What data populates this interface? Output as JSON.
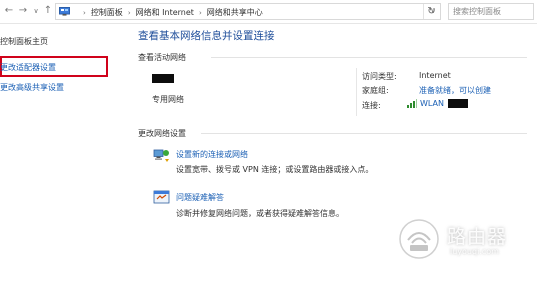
{
  "addressbar": {
    "back_icon": "arrow-left-icon",
    "forward_icon": "arrow-right-icon",
    "dropdown_icon": "chevron-down-icon",
    "up_icon": "arrow-up-icon",
    "breadcrumbs": [
      "控制面板",
      "网络和 Internet",
      "网络和共享中心"
    ],
    "refresh_icon": "refresh-icon",
    "search_placeholder": "搜索控制面板"
  },
  "sidebar": {
    "home": "控制面板主页",
    "items": [
      {
        "label": "更改适配器设置",
        "highlighted": true
      },
      {
        "label": "更改高级共享设置"
      }
    ]
  },
  "main": {
    "title": "查看基本网络信息并设置连接",
    "active_section_label": "查看活动网络",
    "network_type": "专用网络",
    "access": {
      "access_type_key": "访问类型:",
      "access_type_value": "Internet",
      "homegroup_key": "家庭组:",
      "homegroup_value": "准备就绪，可以创建",
      "connections_key": "连接:",
      "connections_value": "WLAN"
    },
    "settings_section_label": "更改网络设置",
    "tasks": [
      {
        "icon": "network-setup-icon",
        "link": "设置新的连接或网络",
        "desc": "设置宽带、拨号或 VPN 连接；或设置路由器或接入点。"
      },
      {
        "icon": "troubleshoot-icon",
        "link": "问题疑难解答",
        "desc": "诊断并修复网络问题，或者获得疑难解答信息。"
      }
    ]
  },
  "watermark": {
    "text": "路由器",
    "sub": "luyouqi.com"
  },
  "colors": {
    "link": "#1a5fb4",
    "title": "#1f4e9a",
    "highlight_border": "#d0021b",
    "wifi_green": "#2e8b2e"
  }
}
